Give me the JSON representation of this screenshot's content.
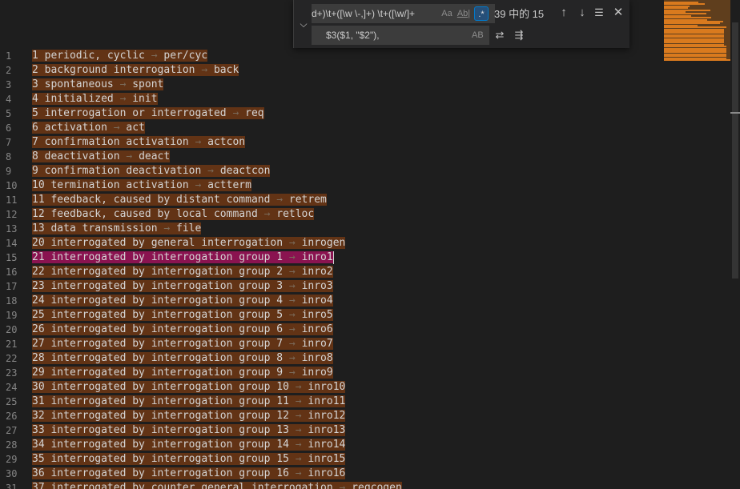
{
  "find_widget": {
    "find_value": "d+)\\t+([\\w \\-,]+) \\t+([\\w/]+",
    "replace_value": "$3($1, \"$2\"),",
    "match_count": "39 中的 15",
    "match_case_label": "Aa",
    "whole_word_label": "Ab|",
    "regex_label": ".*",
    "preserve_case_label": "AB"
  },
  "editor": {
    "active_line": 15,
    "lines": [
      {
        "n": "1",
        "a": "1",
        "b": "periodic, cyclic",
        "c": "per/cyc"
      },
      {
        "n": "2",
        "a": "2",
        "b": "background interrogation",
        "c": "back"
      },
      {
        "n": "3",
        "a": "3",
        "b": "spontaneous",
        "c": "spont"
      },
      {
        "n": "4",
        "a": "4",
        "b": "initialized",
        "c": "init"
      },
      {
        "n": "5",
        "a": "5",
        "b": "interrogation or interrogated",
        "c": "req"
      },
      {
        "n": "6",
        "a": "6",
        "b": "activation",
        "c": "act"
      },
      {
        "n": "7",
        "a": "7",
        "b": "confirmation activation",
        "c": "actcon"
      },
      {
        "n": "8",
        "a": "8",
        "b": "deactivation",
        "c": "deact"
      },
      {
        "n": "9",
        "a": "9",
        "b": "confirmation deactivation",
        "c": "deactcon"
      },
      {
        "n": "10",
        "a": "10",
        "b": "termination activation",
        "c": "actterm"
      },
      {
        "n": "11",
        "a": "11",
        "b": "feedback, caused by distant command",
        "c": "retrem"
      },
      {
        "n": "12",
        "a": "12",
        "b": "feedback, caused by local command",
        "c": "retloc"
      },
      {
        "n": "13",
        "a": "13",
        "b": "data transmission",
        "c": "file"
      },
      {
        "n": "14",
        "a": "20",
        "b": "interrogated by general interrogation",
        "c": "inrogen"
      },
      {
        "n": "15",
        "a": "21",
        "b": "interrogated by interrogation group 1",
        "c": "inro1"
      },
      {
        "n": "16",
        "a": "22",
        "b": "interrogated by interrogation group 2",
        "c": "inro2"
      },
      {
        "n": "17",
        "a": "23",
        "b": "interrogated by interrogation group 3",
        "c": "inro3"
      },
      {
        "n": "18",
        "a": "24",
        "b": "interrogated by interrogation group 4",
        "c": "inro4"
      },
      {
        "n": "19",
        "a": "25",
        "b": "interrogated by interrogation group 5",
        "c": "inro5"
      },
      {
        "n": "20",
        "a": "26",
        "b": "interrogated by interrogation group 6",
        "c": "inro6"
      },
      {
        "n": "21",
        "a": "27",
        "b": "interrogated by interrogation group 7",
        "c": "inro7"
      },
      {
        "n": "22",
        "a": "28",
        "b": "interrogated by interrogation group 8",
        "c": "inro8"
      },
      {
        "n": "23",
        "a": "29",
        "b": "interrogated by interrogation group 9",
        "c": "inro9"
      },
      {
        "n": "24",
        "a": "30",
        "b": "interrogated by interrogation group 10",
        "c": "inro10"
      },
      {
        "n": "25",
        "a": "31",
        "b": "interrogated by interrogation group 11",
        "c": "inro11"
      },
      {
        "n": "26",
        "a": "32",
        "b": "interrogated by interrogation group 12",
        "c": "inro12"
      },
      {
        "n": "27",
        "a": "33",
        "b": "interrogated by interrogation group 13",
        "c": "inro13"
      },
      {
        "n": "28",
        "a": "34",
        "b": "interrogated by interrogation group 14",
        "c": "inro14"
      },
      {
        "n": "29",
        "a": "35",
        "b": "interrogated by interrogation group 15",
        "c": "inro15"
      },
      {
        "n": "30",
        "a": "36",
        "b": "interrogated by interrogation group 16",
        "c": "inro16"
      },
      {
        "n": "31",
        "a": "37",
        "b": "interrogated by counter general interrogation",
        "c": "reqcogen"
      }
    ]
  },
  "colors": {
    "match_highlight": "#623315",
    "current_match": "#8a1350",
    "minimap_accent": "#d97a1e"
  }
}
